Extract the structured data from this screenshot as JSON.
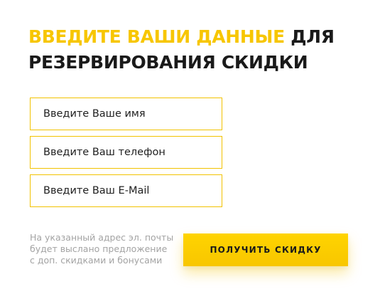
{
  "heading": {
    "accent": "ВВЕДИТЕ ВАШИ ДАННЫЕ",
    "rest_line1": "ДЛЯ",
    "line2": "РЕЗЕРВИРОВАНИЯ СКИДКИ"
  },
  "form": {
    "name_placeholder": "Введите Ваше имя",
    "phone_placeholder": "Введите Ваш телефон",
    "email_placeholder": "Введите Ваш E-Mail"
  },
  "note": {
    "line1": "На указанный адрес эл. почты",
    "line2": "будет выслано предложение",
    "line3": "с доп. скидками и бонусами"
  },
  "cta": {
    "label": "ПОЛУЧИТЬ СКИДКУ"
  },
  "colors": {
    "accent": "#f7c600",
    "text": "#1a1a1a",
    "muted": "#a3a3a3",
    "field_border": "#f2c200"
  }
}
